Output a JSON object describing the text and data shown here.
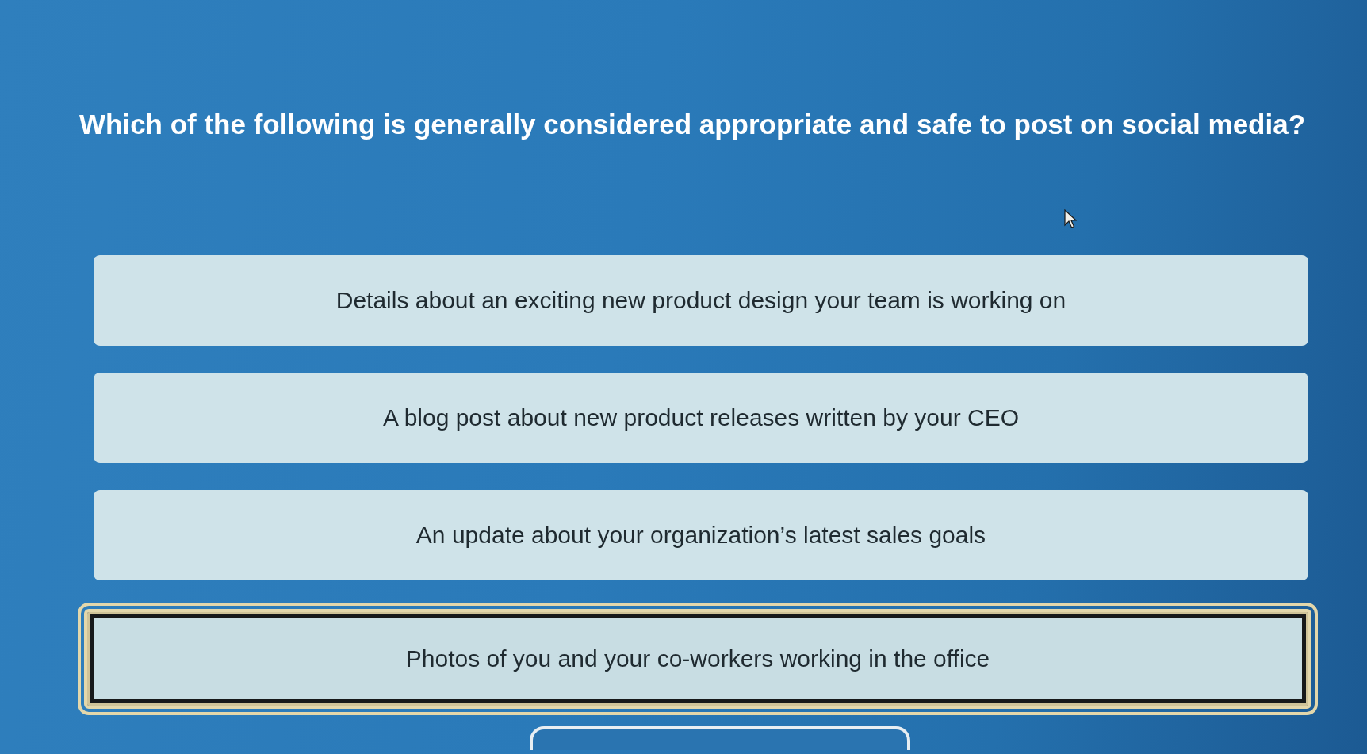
{
  "question": {
    "text": "Which of the following is generally considered appropriate and safe to post on social media?"
  },
  "options": [
    {
      "text": "Details about an exciting new product design your team is working on",
      "selected": false
    },
    {
      "text": "A blog post about new product releases written by your CEO",
      "selected": false
    },
    {
      "text": "An update about your organization’s latest sales goals",
      "selected": false
    },
    {
      "text": "Photos of you and your co-workers working in the office",
      "selected": true
    }
  ]
}
